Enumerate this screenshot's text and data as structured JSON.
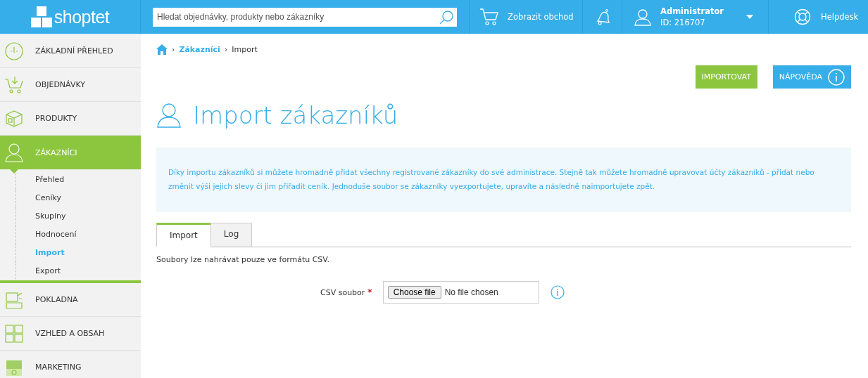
{
  "header": {
    "logo": "shoptet",
    "search": {
      "placeholder": "Hledat objednávky, produkty nebo zákazníky"
    },
    "shop_link": "Zobrazit obchod",
    "user": {
      "name": "Administrator",
      "id": "ID: 216707"
    },
    "helpdesk": "Helpdesk"
  },
  "sidebar": {
    "items": [
      {
        "label": "ZÁKLADNÍ PŘEHLED",
        "selected": false
      },
      {
        "label": "OBJEDNÁVKY",
        "selected": false
      },
      {
        "label": "PRODUKTY",
        "selected": false
      },
      {
        "label": "ZÁKAZNÍCI",
        "selected": true,
        "expanded": true,
        "children": [
          {
            "label": "Přehled",
            "selected": false
          },
          {
            "label": "Ceníky",
            "selected": false
          },
          {
            "label": "Skupiny",
            "selected": false
          },
          {
            "label": "Hodnocení",
            "selected": false
          },
          {
            "label": "Import",
            "selected": true
          },
          {
            "label": "Export",
            "selected": false
          }
        ]
      },
      {
        "label": "POKLADNA",
        "selected": false
      },
      {
        "label": "VZHLED A OBSAH",
        "selected": false
      },
      {
        "label": "MARKETING",
        "selected": false
      }
    ]
  },
  "breadcrumb": [
    {
      "separator": "›",
      "label": "Zákazníci",
      "kind": "link"
    },
    {
      "separator": "›",
      "label": "Import",
      "kind": "current"
    }
  ],
  "actions": [
    {
      "label": "IMPORTOVAT",
      "kind": "primary"
    },
    {
      "label": "NÁPOVĚDA",
      "kind": "help"
    }
  ],
  "title": "Import zákazníků",
  "info": "Díky importu zákazníků si můžete hromadně přidat všechny registrované zákazníky do své administrace. Stejně tak můžete hromadně upravovat účty zákazníků - přidat nebo změnit výši jejich slevy či jim přiřadit ceník. Jednoduše soubor se zákazníky vyexportujete, upravíte a následně naimportujete zpět.",
  "tabs": [
    {
      "label": "Import",
      "selected": true
    },
    {
      "label": "Log",
      "selected": false
    }
  ],
  "note": "Soubory lze nahrávat pouze ve formátu CSV.",
  "form": {
    "label": "CSV soubor",
    "required_mark": "*",
    "button": "Choose file",
    "value": "No file chosen"
  }
}
